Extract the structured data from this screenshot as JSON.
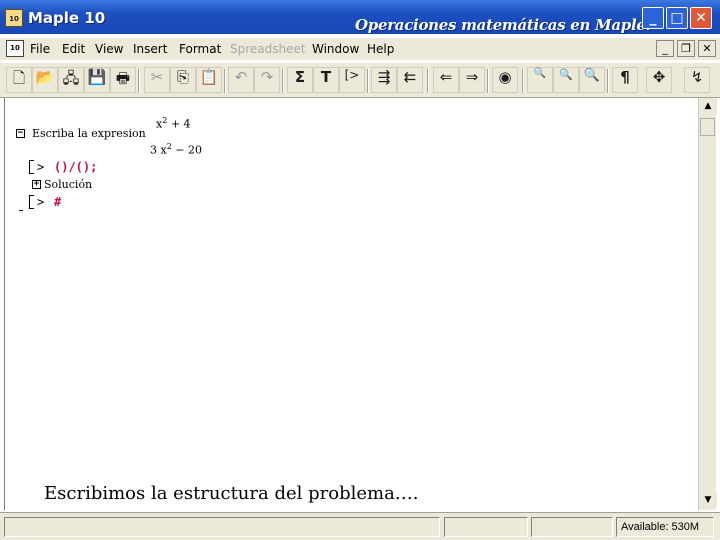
{
  "window": {
    "app_title": "Maple 10",
    "app_icon_text": "10",
    "caption": "Operaciones matemáticas en Maple.",
    "controls": {
      "minimize": "_",
      "maximize": "□",
      "close": "✕"
    }
  },
  "menubar": {
    "doc_icon_text": "10",
    "items": [
      {
        "label": "File",
        "enabled": true
      },
      {
        "label": "Edit",
        "enabled": true
      },
      {
        "label": "View",
        "enabled": true
      },
      {
        "label": "Insert",
        "enabled": true
      },
      {
        "label": "Format",
        "enabled": true
      },
      {
        "label": "Spreadsheet",
        "enabled": false
      },
      {
        "label": "Window",
        "enabled": true
      },
      {
        "label": "Help",
        "enabled": true
      }
    ],
    "mdi_controls": {
      "minimize": "_",
      "restore": "❐",
      "close": "✕"
    }
  },
  "toolbar": {
    "buttons": [
      {
        "icon": "new-document-icon",
        "glyph": "🗋",
        "enabled": true
      },
      {
        "icon": "open-folder-icon",
        "glyph": "📂",
        "enabled": true
      },
      {
        "icon": "open-url-icon",
        "glyph": "🖧",
        "enabled": true
      },
      {
        "icon": "save-icon",
        "glyph": "💾",
        "enabled": true
      },
      {
        "icon": "print-icon",
        "glyph": "🖶",
        "enabled": true
      },
      {
        "icon": "cut-icon",
        "glyph": "✂",
        "enabled": false
      },
      {
        "icon": "copy-icon",
        "glyph": "⎘",
        "enabled": true
      },
      {
        "icon": "paste-icon",
        "glyph": "📋",
        "enabled": true
      },
      {
        "icon": "undo-icon",
        "glyph": "↶",
        "enabled": false
      },
      {
        "icon": "redo-icon",
        "glyph": "↷",
        "enabled": false
      },
      {
        "icon": "sum-icon",
        "glyph": "Σ",
        "enabled": true
      },
      {
        "icon": "text-mode-icon",
        "glyph": "T",
        "enabled": true
      },
      {
        "icon": "input-prompt-icon",
        "glyph": "[>",
        "enabled": true
      },
      {
        "icon": "indent-icon",
        "glyph": "⇶",
        "enabled": true
      },
      {
        "icon": "outdent-icon",
        "glyph": "⇇",
        "enabled": true
      },
      {
        "icon": "back-arrow-icon",
        "glyph": "⇐",
        "enabled": true
      },
      {
        "icon": "forward-arrow-icon",
        "glyph": "⇒",
        "enabled": true
      },
      {
        "icon": "stop-icon",
        "glyph": "◉",
        "enabled": true
      },
      {
        "icon": "zoom-100-icon",
        "glyph": "🔍",
        "enabled": true
      },
      {
        "icon": "zoom-150-icon",
        "glyph": "🔍",
        "enabled": true
      },
      {
        "icon": "zoom-200-icon",
        "glyph": "🔍",
        "enabled": true
      },
      {
        "icon": "pilcrow-icon",
        "glyph": "¶",
        "enabled": true
      },
      {
        "icon": "expand-arrows-icon",
        "glyph": "✥",
        "enabled": true
      },
      {
        "icon": "restart-icon",
        "glyph": "↯",
        "enabled": true
      }
    ]
  },
  "worksheet": {
    "section_title": "Escriba la expresion",
    "expression": {
      "numerator": "x",
      "numerator_exp": "2",
      "numerator_rest": "+ 4",
      "denominator_coef": "3 x",
      "denominator_exp": "2",
      "denominator_rest": "− 20"
    },
    "prompt_symbol": ">",
    "input_line": "()/();",
    "solution_label": "Solución",
    "input_line_2": "#",
    "collapse_minus": "−",
    "collapse_plus": "+"
  },
  "annotation": "Escribimos la estructura del problema….",
  "statusbar": {
    "available": "Available: 530M"
  }
}
